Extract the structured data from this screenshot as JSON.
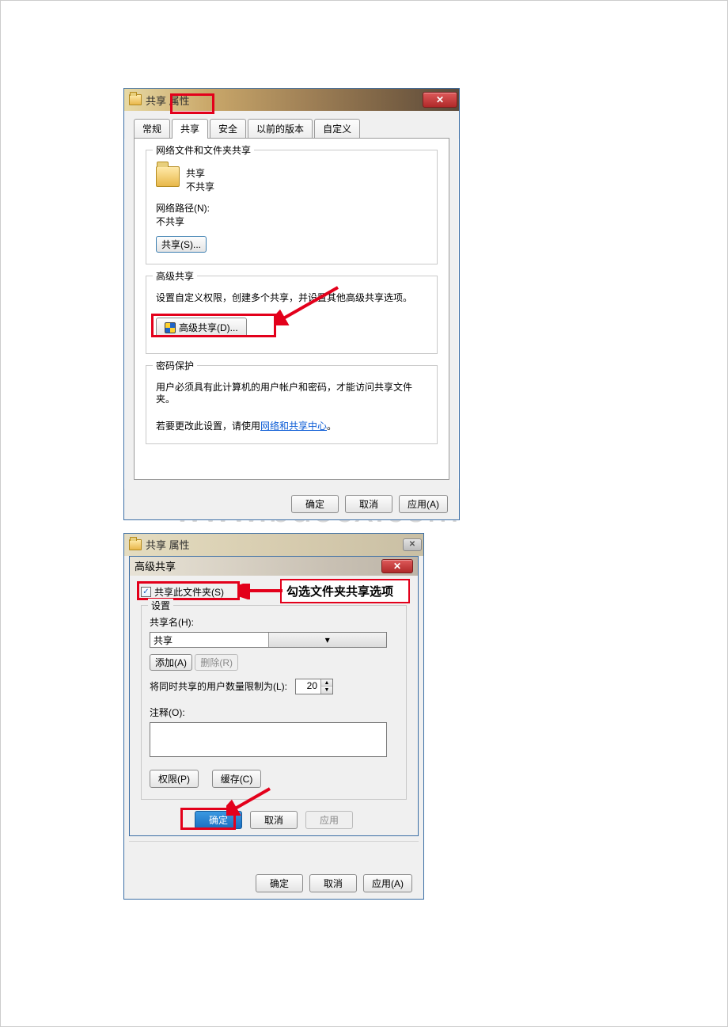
{
  "watermark": "www.bdocx.com",
  "dlg1": {
    "title": "共享 属性",
    "tabs": {
      "t0": "常规",
      "t1": "共享",
      "t2": "安全",
      "t3": "以前的版本",
      "t4": "自定义"
    },
    "group_net": {
      "legend": "网络文件和文件夹共享",
      "name": "共享",
      "status": "不共享",
      "path_lbl": "网络路径(N):",
      "path_val": "不共享",
      "share_btn": "共享(S)..."
    },
    "group_adv": {
      "legend": "高级共享",
      "desc": "设置自定义权限，创建多个共享，并设置其他高级共享选项。",
      "btn": "高级共享(D)..."
    },
    "group_pwd": {
      "legend": "密码保护",
      "desc": "用户必须具有此计算机的用户帐户和密码，才能访问共享文件夹。",
      "hint_a": "若要更改此设置，请使用",
      "hint_link": "网络和共享中心",
      "hint_b": "。"
    },
    "ok": "确定",
    "cancel": "取消",
    "apply": "应用(A)"
  },
  "dlg2": {
    "title_prop": "共享 属性",
    "title_adv": "高级共享",
    "chk_label": "共享此文件夹(S)",
    "callout": "勾选文件夹共享选项",
    "fset_legend": "设置",
    "name_lbl": "共享名(H):",
    "name_val": "共享",
    "add": "添加(A)",
    "remove": "删除(R)",
    "limit_lbl": "将同时共享的用户数量限制为(L):",
    "limit_val": "20",
    "note_lbl": "注释(O):",
    "perm": "权限(P)",
    "cache": "缓存(C)",
    "ok": "确定",
    "cancel": "取消",
    "apply": "应用",
    "outer_ok": "确定",
    "outer_cancel": "取消",
    "outer_apply": "应用(A)"
  }
}
